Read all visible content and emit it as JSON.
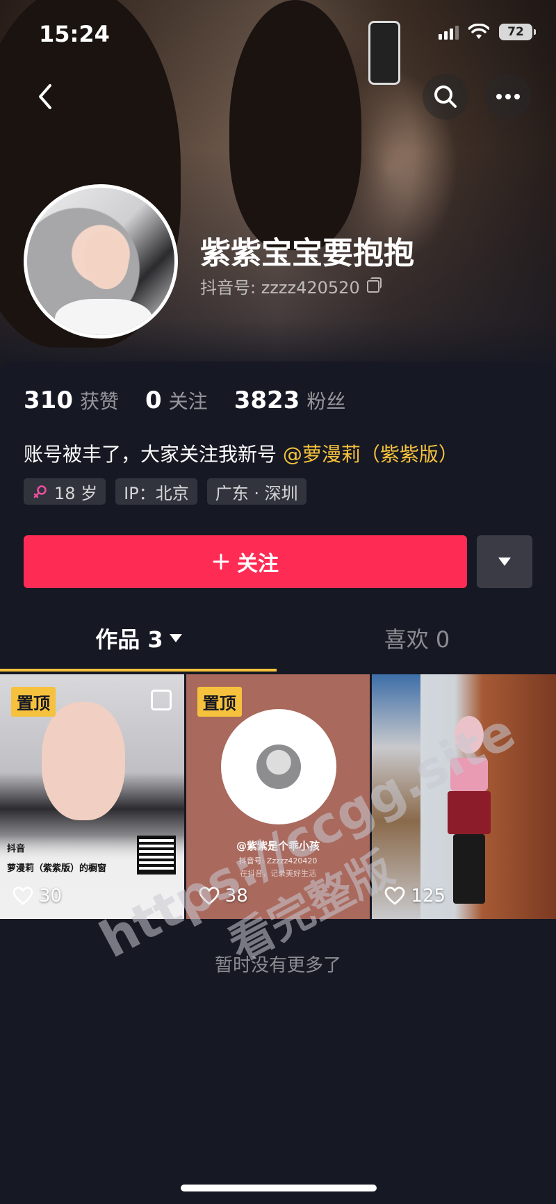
{
  "status_bar": {
    "time": "15:24",
    "battery": "72"
  },
  "profile": {
    "name": "紫紫宝宝要抱抱",
    "douyin_id": "抖音号: zzzz420520",
    "stats": [
      {
        "value": "310",
        "label": "获赞"
      },
      {
        "value": "0",
        "label": "关注"
      },
      {
        "value": "3823",
        "label": "粉丝"
      }
    ],
    "bio_text": "账号被丰了，大家关注我新号",
    "bio_mention": "@萝漫莉（紫紫版）",
    "tags": [
      {
        "icon": "female-icon",
        "text": "18 岁"
      },
      {
        "text": "IP：北京"
      },
      {
        "text": "广东 · 深圳"
      }
    ]
  },
  "actions": {
    "follow_label": "关注"
  },
  "tabs": [
    {
      "label": "作品 3",
      "active": true
    },
    {
      "label": "喜欢 0",
      "active": false
    }
  ],
  "videos": [
    {
      "pinned_label": "置顶",
      "likes": "30",
      "brand": "抖音",
      "caption": "萝漫莉（紫紫版）的橱窗"
    },
    {
      "pinned_label": "置顶",
      "likes": "38",
      "qr_title": "@紫紫是个乖小孩",
      "qr_id": "抖音号: Zzzzz420420",
      "qr_slogan": "在抖音，记录美好生活"
    },
    {
      "likes": "125"
    }
  ],
  "footer": {
    "no_more": "暂时没有更多了"
  },
  "watermark": {
    "line1": "https://ccgg.site",
    "line2": "看完整版"
  },
  "colors": {
    "accent": "#fe2c55",
    "highlight": "#f6c23d",
    "background": "#161823"
  }
}
